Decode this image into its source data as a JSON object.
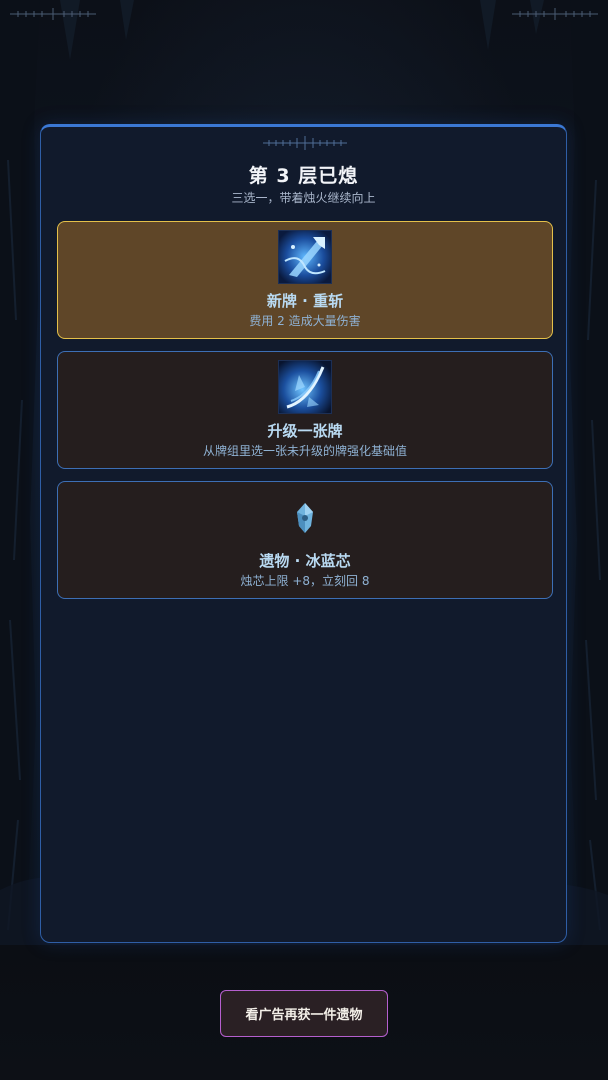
{
  "header": {
    "title": "第 3 层已熄",
    "subtitle": "三选一，带着烛火继续向上"
  },
  "options": [
    {
      "name": "新牌 · 重斩",
      "description": "费用 2  造成大量伤害",
      "icon": "heavy-slash-card-icon",
      "selected": true
    },
    {
      "name": "升级一张牌",
      "description": "从牌组里选一张未升级的牌强化基础值",
      "icon": "upgrade-slash-icon",
      "selected": false
    },
    {
      "name": "遗物 · 冰蓝芯",
      "description": "烛芯上限 +8，立刻回 8",
      "icon": "ice-crystal-icon",
      "selected": false
    }
  ],
  "ad_button": {
    "label": "看广告再获一件遗物"
  },
  "colors": {
    "panel_border": "#3b78d4",
    "selected_fill": "#5f4628",
    "selected_border": "#e4c04a",
    "option_border": "#3d6fb5",
    "ad_border": "#b55fce"
  }
}
